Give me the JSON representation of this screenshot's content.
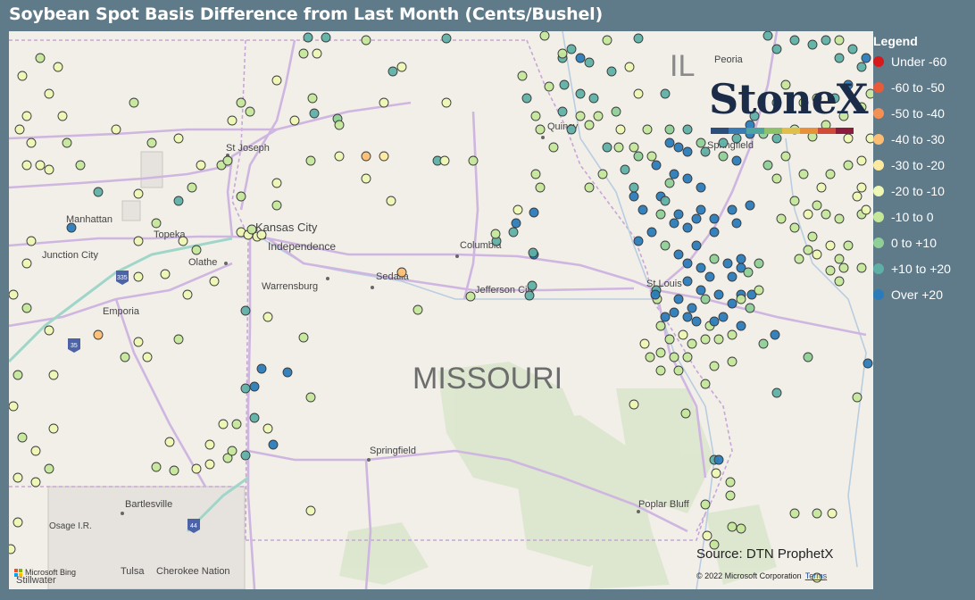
{
  "title": "Soybean Spot Basis Difference from Last Month (Cents/Bushel)",
  "legend": {
    "title": "Legend",
    "items": [
      {
        "label": "Under -60",
        "color": "#d7191c"
      },
      {
        "label": "-60 to -50",
        "color": "#e85b3a"
      },
      {
        "label": "-50 to -40",
        "color": "#f59053"
      },
      {
        "label": "-40 to -30",
        "color": "#fdbe74"
      },
      {
        "label": "-30 to -20",
        "color": "#feea9f"
      },
      {
        "label": "-20 to -10",
        "color": "#eef7b4"
      },
      {
        "label": "-10 to 0",
        "color": "#c4e79a"
      },
      {
        "label": "0 to +10",
        "color": "#8fd097"
      },
      {
        "label": "+10 to +20",
        "color": "#5eb0a6"
      },
      {
        "label": "Over +20",
        "color": "#2b7bba"
      }
    ]
  },
  "map": {
    "state_label": "MISSOURI",
    "partial_label": "IL",
    "cities": [
      "St Joseph",
      "Manhattan",
      "Topeka",
      "Kansas City",
      "Independence",
      "Junction City",
      "Olathe",
      "Columbia",
      "Sedalia",
      "Warrensburg",
      "Jefferson City",
      "Emporia",
      "St Louis",
      "Springfield",
      "Quincy",
      "Springfield",
      "Bartlesville",
      "Osage I.R.",
      "Tulsa",
      "Cherokee Nation",
      "Poplar Bluff",
      "Peoria",
      "Stillwater"
    ],
    "highway_shields": [
      "335",
      "35",
      "44"
    ]
  },
  "logo": {
    "text": "StoneX",
    "bar_colors": [
      "#2b4f7a",
      "#3a7bb5",
      "#4fa3a0",
      "#8dc16a",
      "#e0c04a",
      "#e8913b",
      "#d24b3a",
      "#8a1d3b"
    ]
  },
  "source": "Source: DTN ProphetX",
  "copyright": "© 2022 Microsoft Corporation",
  "terms_link": "Terms",
  "bing": "Microsoft Bing"
}
